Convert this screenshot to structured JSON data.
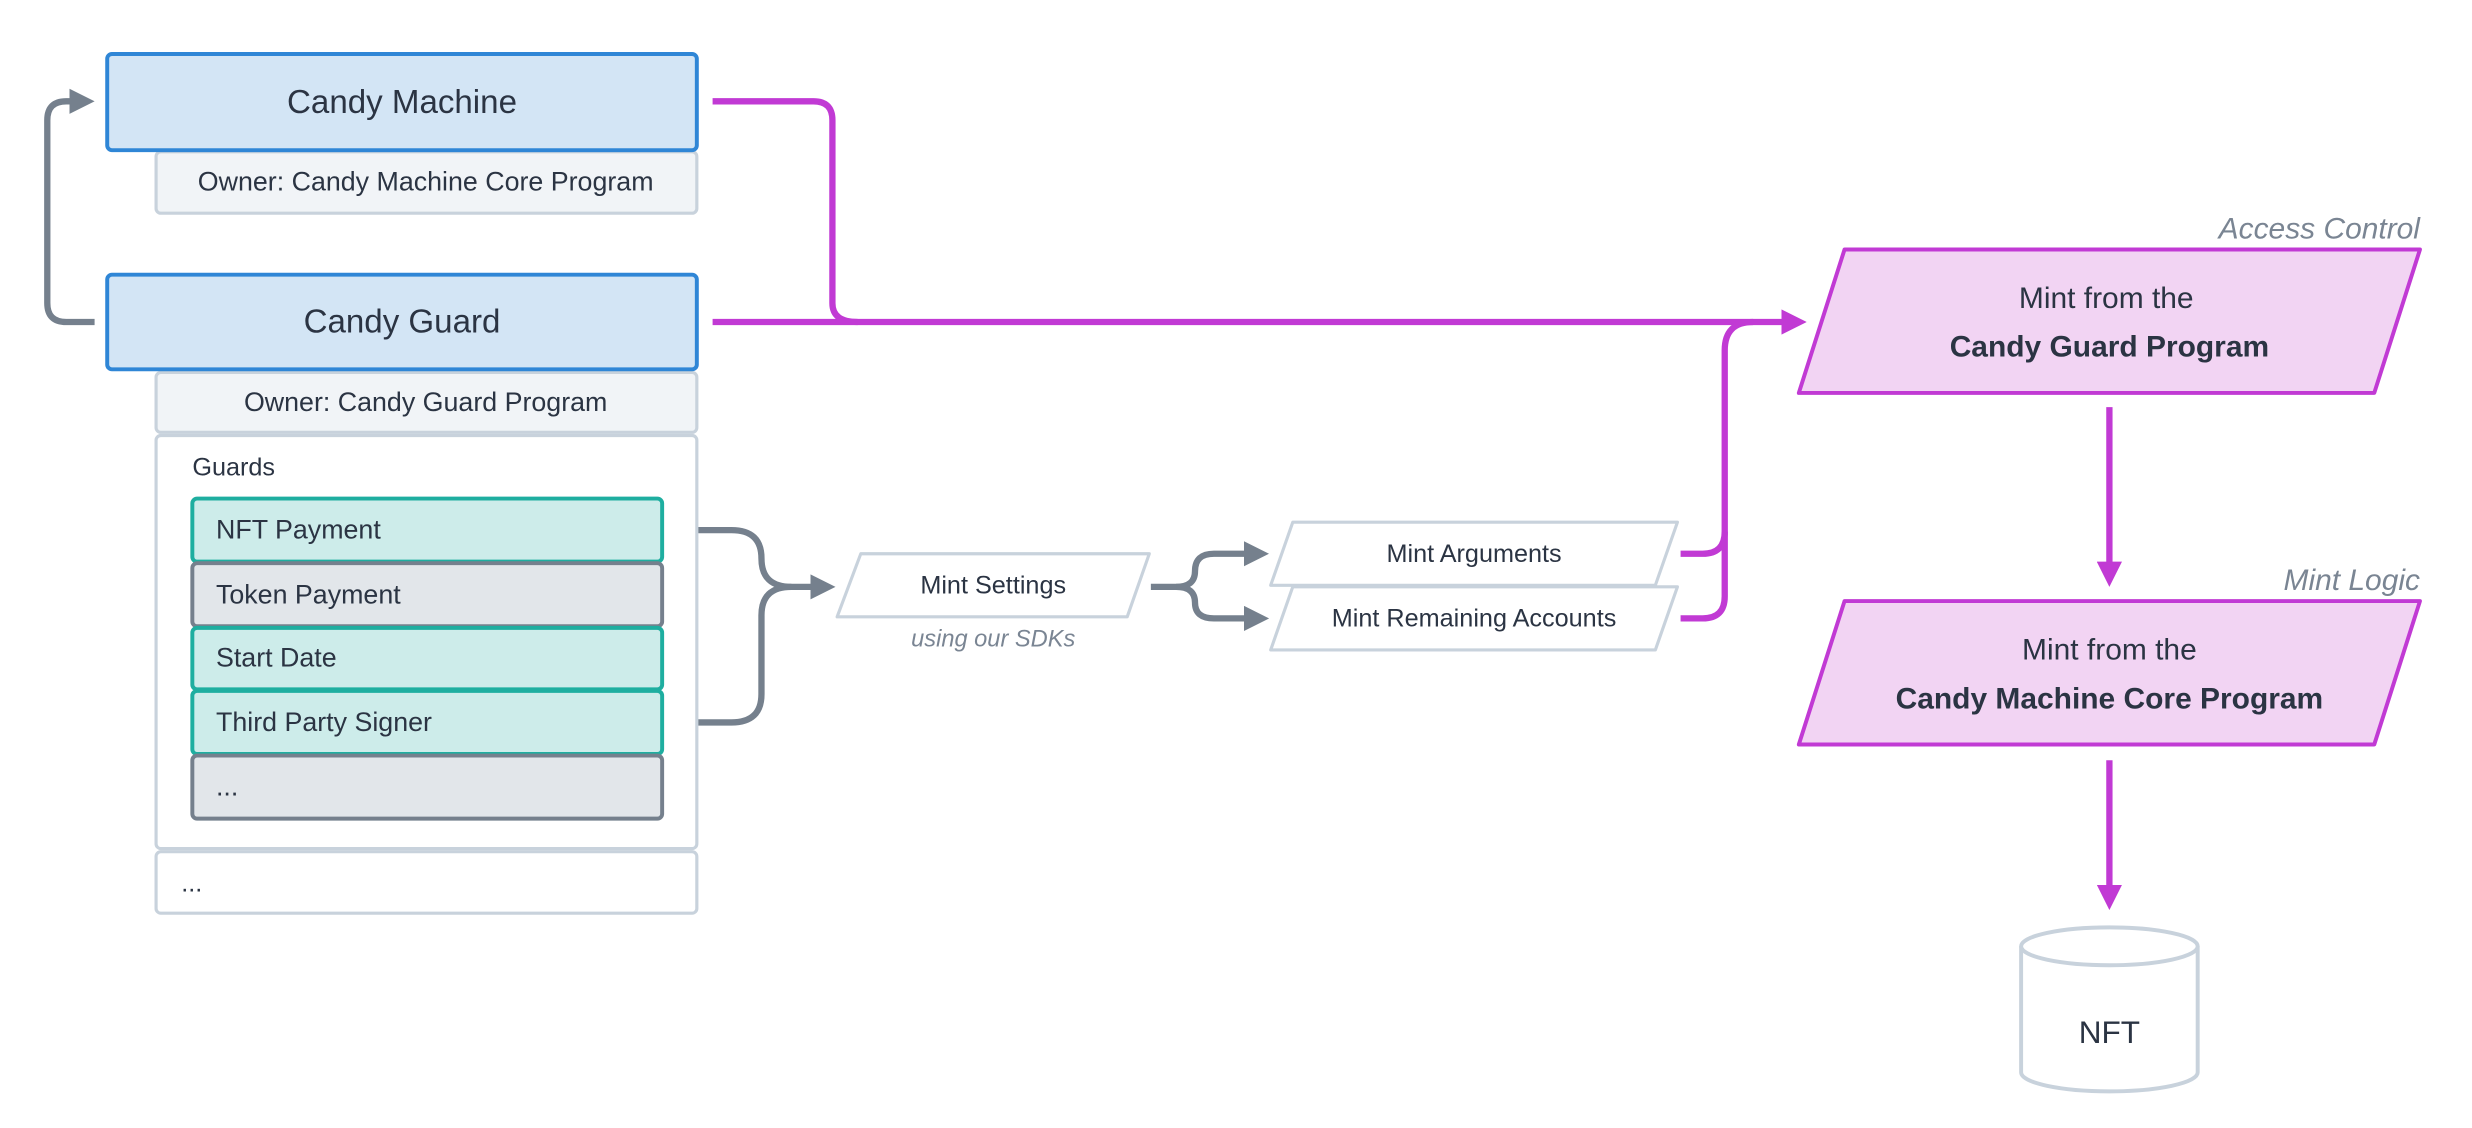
{
  "accounts": {
    "candy_machine": {
      "title": "Candy Machine",
      "owner": "Owner: Candy Machine Core Program"
    },
    "candy_guard": {
      "title": "Candy Guard",
      "owner": "Owner: Candy Guard Program"
    },
    "guards_label": "Guards",
    "guards": [
      {
        "label": "NFT Payment",
        "enabled": true
      },
      {
        "label": "Token Payment",
        "enabled": false
      },
      {
        "label": "Start Date",
        "enabled": true
      },
      {
        "label": "Third Party Signer",
        "enabled": true
      },
      {
        "label": "...",
        "enabled": false
      }
    ],
    "more": "..."
  },
  "mint_settings": {
    "label": "Mint Settings",
    "caption": "using our SDKs"
  },
  "mint_inputs": [
    "Mint Arguments",
    "Mint Remaining Accounts"
  ],
  "programs": [
    {
      "section": "Access Control",
      "line1": "Mint from the",
      "line2": "Candy Guard Program"
    },
    {
      "section": "Mint Logic",
      "line1": "Mint from the",
      "line2": "Candy Machine Core Program"
    }
  ],
  "output": "NFT",
  "colors": {
    "account_fill": "#d3e5f5",
    "account_stroke": "#2f86d6",
    "enabled_fill": "#cdecea",
    "enabled_stroke": "#1eaea0",
    "disabled_fill": "#e2e6ea",
    "disabled_stroke": "#75808d",
    "flow": "#c13ad4",
    "program_fill": "#f2d4f3",
    "connector": "#75808d"
  }
}
